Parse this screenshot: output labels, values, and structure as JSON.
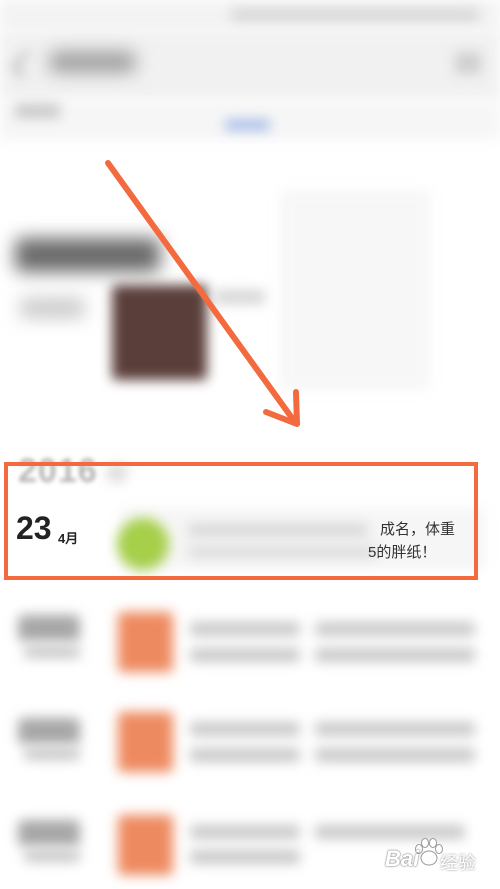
{
  "timeline": {
    "year": "2016",
    "highlighted_entry": {
      "day": "23",
      "month": "4月",
      "text_line1": "成名，体重",
      "text_line2": "5的胖纸！"
    }
  },
  "watermark": {
    "brand": "Bai",
    "suffix": "经验"
  },
  "colors": {
    "highlight": "#f26a3d",
    "avatar_green": "#a6cf4a",
    "item_icon_orange": "#ee8a60"
  }
}
